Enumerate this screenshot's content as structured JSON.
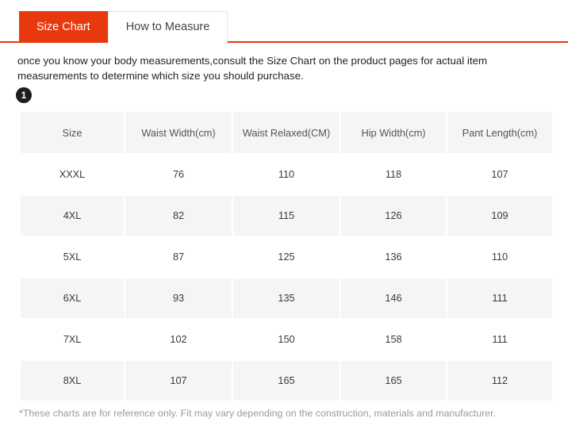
{
  "tabs": [
    {
      "label": "Size Chart",
      "active": true
    },
    {
      "label": "How to Measure",
      "active": false
    }
  ],
  "intro": {
    "text": "once you know your body measurements,consult the Size Chart on the product pages for actual item measurements to determine which size you should purchase."
  },
  "badge": {
    "label": "1"
  },
  "colors": {
    "accent": "#e8380d",
    "cell_shaded": "#f5f5f5",
    "badge_bg": "#1d1d1d",
    "note_text": "#9b9b9b"
  },
  "table": {
    "headers": [
      "Size",
      "Waist Width(cm)",
      "Waist Relaxed(CM)",
      "Hip Width(cm)",
      "Pant Length(cm)"
    ],
    "rows": [
      [
        "XXXL",
        "76",
        "110",
        "118",
        "107"
      ],
      [
        "4XL",
        "82",
        "115",
        "126",
        "109"
      ],
      [
        "5XL",
        "87",
        "125",
        "136",
        "110"
      ],
      [
        "6XL",
        "93",
        "135",
        "146",
        "111"
      ],
      [
        "7XL",
        "102",
        "150",
        "158",
        "111"
      ],
      [
        "8XL",
        "107",
        "165",
        "165",
        "112"
      ]
    ]
  },
  "note": {
    "text": "*These charts are for reference only. Fit may vary depending on the construction, materials and manufacturer."
  }
}
